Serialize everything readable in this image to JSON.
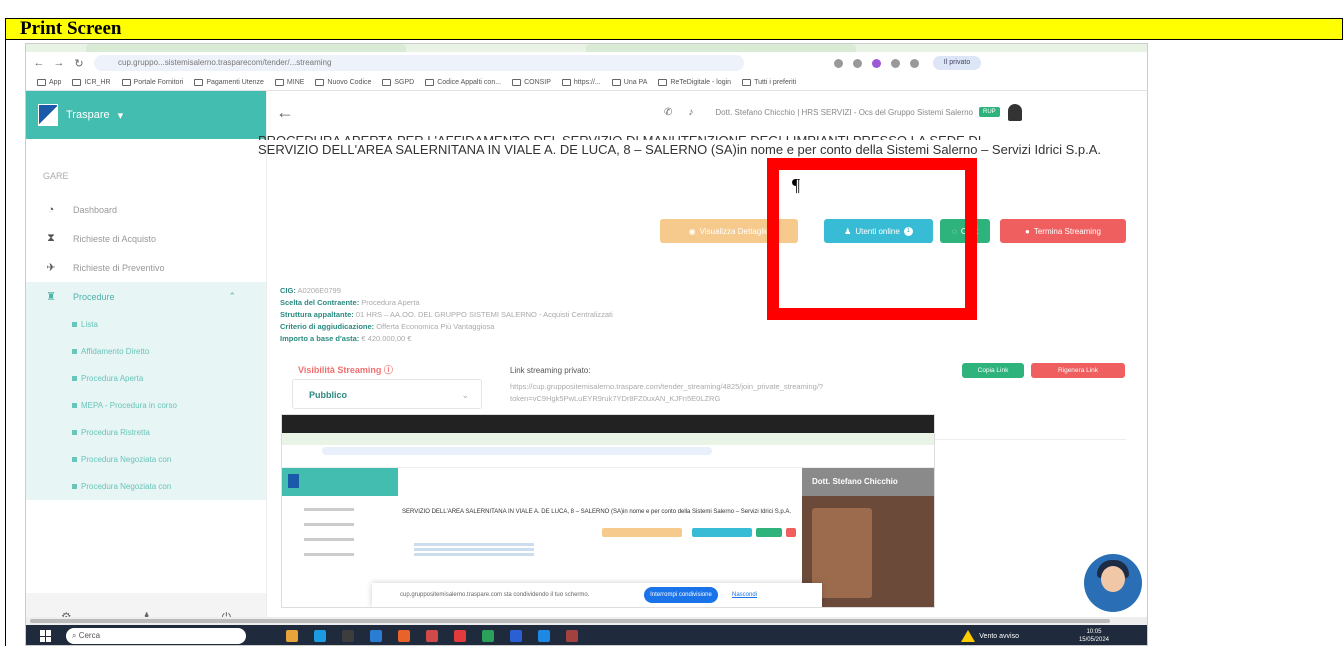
{
  "doc": {
    "header": "Print Screen"
  },
  "browser": {
    "url": "cup.gruppo...sistemisalerno.trasparecom/tender/...streaming",
    "profile": "Il privato",
    "bookmarks": [
      "App",
      "ICR_HR",
      "Portale Fornitori",
      "Pagamenti Utenze",
      "MINE",
      "Nuovo Codice",
      "SGPD",
      "Codice Appalti con...",
      "CONSIP",
      "https://...",
      "Una PA",
      "ReTeDigitale - login",
      "Tutti i preferiti"
    ]
  },
  "sidebar": {
    "brand": "Traspare",
    "section": "GARE",
    "items": [
      {
        "label": "Dashboard",
        "icon": "dashboard-icon"
      },
      {
        "label": "Richieste di Acquisto",
        "icon": "hourglass-icon"
      },
      {
        "label": "Richieste di Preventivo",
        "icon": "send-icon"
      },
      {
        "label": "Procedure",
        "icon": "trophy-icon"
      }
    ],
    "sub_items": [
      "Lista",
      "Affidamento Diretto",
      "Procedura Aperta",
      "MEPA - Procedura in corso",
      "Procedura Ristretta",
      "Procedura Negoziata con",
      "Procedura Negoziata con"
    ]
  },
  "topbar": {
    "user": "Dott. Stefano Chicchio | HRS SERVIZI - Ocs del Gruppo Sistemi Salerno",
    "badge": "RUP"
  },
  "main": {
    "title_cut": "PROCEDURA APERTA PER L'AFFIDAMENTO DEL SERVIZIO DI MANUTENZIONE DEGLI IMPIANTI PRESSO LA SEDE DI",
    "title": "SERVIZIO DELL'AREA SALERNITANA IN VIALE A. DE LUCA, 8 – SALERNO (SA)in nome e per conto della Sistemi Salerno – Servizi Idrici S.p.A.",
    "overlay_fragment": "nome e per conto della Sistemi",
    "buttons": {
      "orange": "Visualizza Dettaglio",
      "blue": "Utenti online",
      "blue_count": "1",
      "green": "Chat",
      "red": "Termina Streaming"
    },
    "details": [
      {
        "k": "CIG:",
        "v": "A0206E0799"
      },
      {
        "k": "Scelta del Contraente:",
        "v": "Procedura Aperta"
      },
      {
        "k": "Struttura appaltante:",
        "v": "01 HRS – AA.OO. DEL GRUPPO SISTEMI SALERNO - Acquisti Centralizzati"
      },
      {
        "k": "Criterio di aggiudicazione:",
        "v": "Offerta Economica Più Vantaggiosa"
      },
      {
        "k": "Importo a base d'asta:",
        "v": "€ 420.000,00 €"
      }
    ],
    "visibility_label": "Visibilità Streaming",
    "visibility_value": "Pubblico",
    "link_label": "Link streaming privato:",
    "link_url": "https://cup.gruppositemisalerno.traspare.com/tender_streaming/4825/join_private_streaming/?token=vC9Hgk5PwLuEYR9ruk7YDr8FZ0uxAN_KJFn5E0LZRG",
    "copy_link": "Copia Link",
    "regen_link": "Rigenera Link"
  },
  "nested": {
    "title": "SERVIZIO DELL'AREA SALERNITANA IN VIALE A. DE LUCA, 8 – SALERNO (SA)in nome e per conto della Sistemi Salerno – Servizi Idrici S.p.A.",
    "video_name": "Dott. Stefano Chicchio",
    "cookie_text": "cup.gruppositemisalerno.traspare.com sta condividendo il tuo schermo.",
    "cookie_button": "Interrompi condivisione",
    "cookie_link": "Nascondi"
  },
  "taskbar": {
    "search": "Cerca",
    "weather": "Vento avviso",
    "time": "10:05",
    "date": "15/05/2024"
  }
}
